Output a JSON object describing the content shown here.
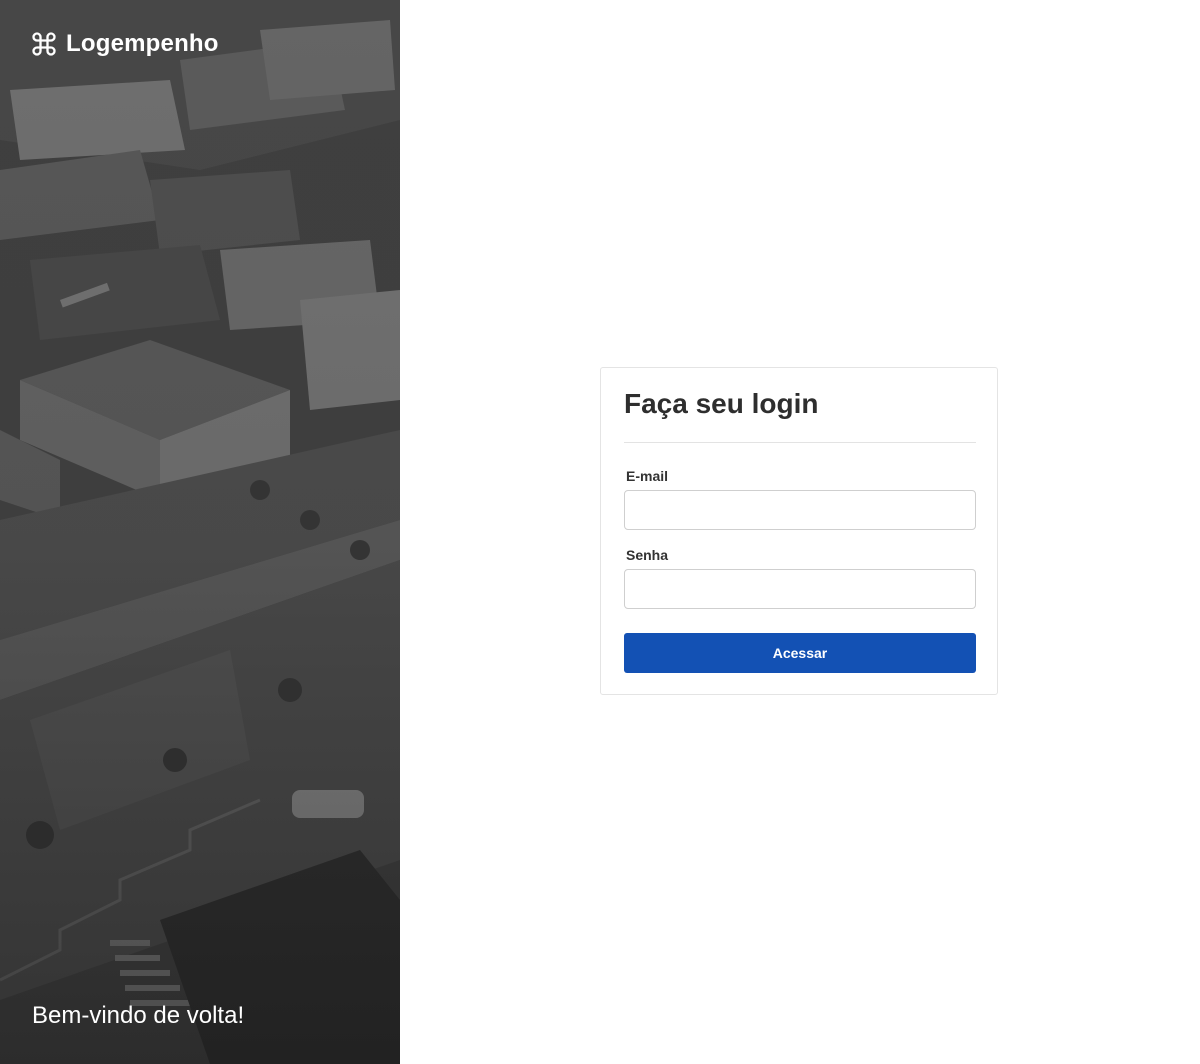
{
  "app": {
    "brand_name": "Logempenho",
    "brand_icon": "command-icon"
  },
  "hero": {
    "welcome_text": "Bem-vindo de volta!"
  },
  "login": {
    "title": "Faça seu login",
    "email_label": "E-mail",
    "email_value": "",
    "email_placeholder": "",
    "password_label": "Senha",
    "password_value": "",
    "password_placeholder": "",
    "submit_label": "Acessar"
  },
  "colors": {
    "primary_button": "#1351b4",
    "hero_background": "#3e3e3e",
    "text_dark": "#2e2e2e"
  }
}
